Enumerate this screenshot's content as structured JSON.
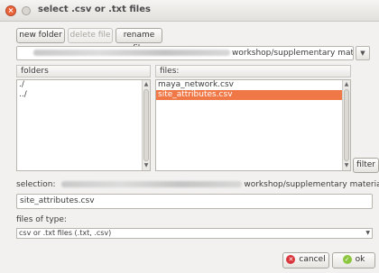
{
  "window": {
    "title": "select .csv or .txt files",
    "close_glyph": "×"
  },
  "toolbar": {
    "new_folder": "new folder",
    "delete_file": "delete file",
    "rename_file": "rename file"
  },
  "path": {
    "visible_suffix": "workshop/supplementary material",
    "dropdown_glyph": "▼"
  },
  "folders": {
    "header": "folders",
    "items": [
      "./",
      "../"
    ]
  },
  "files": {
    "header": "files:",
    "items": [
      {
        "name": "maya_network.csv",
        "selected": false
      },
      {
        "name": "site_attributes.csv",
        "selected": true
      }
    ]
  },
  "filter_button": "filter",
  "selection": {
    "label": "selection:",
    "path_suffix": "workshop/supplementary material",
    "value": "site_attributes.csv"
  },
  "file_types": {
    "label": "files of type:",
    "selected": "csv or .txt files (.txt, .csv)",
    "dropdown_glyph": "▼"
  },
  "dialog_buttons": {
    "cancel": "cancel",
    "ok": "ok"
  },
  "colors": {
    "accent_selection": "#f07746",
    "close_button": "#e9633b",
    "ok_icon": "#8cc63e",
    "cancel_icon": "#d9353b"
  },
  "icons": {
    "close": "close-icon",
    "minimize": "minimize-icon",
    "cancel": "cancel-icon",
    "ok": "checkmark-icon"
  }
}
